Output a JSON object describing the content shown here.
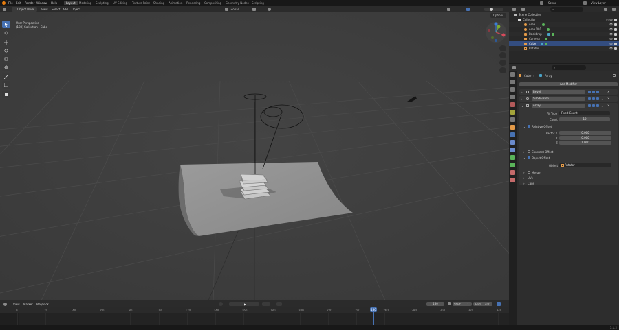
{
  "topbar": {
    "menus": [
      "File",
      "Edit",
      "Render",
      "Window",
      "Help"
    ],
    "workspaces": [
      "Layout",
      "Modeling",
      "Sculpting",
      "UV Editing",
      "Texture Paint",
      "Shading",
      "Animation",
      "Rendering",
      "Compositing",
      "Geometry Nodes",
      "Scripting"
    ],
    "active_workspace": "Layout",
    "scene": "Scene",
    "view_layer": "View Layer"
  },
  "viewport_header": {
    "mode": "Object Mode",
    "menus": [
      "View",
      "Select",
      "Add",
      "Object"
    ],
    "orientation": "Global",
    "options": "Options"
  },
  "viewport": {
    "perspective": "User Perspective",
    "collection_info": "(180) Collection | Cube"
  },
  "outliner": {
    "root": "Scene Collection",
    "collection": "Collection",
    "items": [
      {
        "name": "Area",
        "icon": "light-icon",
        "selected": false
      },
      {
        "name": "Area.001",
        "icon": "light-icon",
        "selected": false
      },
      {
        "name": "Backdrop",
        "icon": "mesh-icon",
        "selected": false
      },
      {
        "name": "Camera",
        "icon": "camera-icon",
        "selected": false
      },
      {
        "name": "Cube",
        "icon": "mesh-icon",
        "selected": true
      },
      {
        "name": "Rotator",
        "icon": "empty-icon",
        "selected": false
      }
    ]
  },
  "properties": {
    "breadcrumb_object": "Cube",
    "breadcrumb_modifier": "Array",
    "add_modifier": "Add Modifier",
    "modifiers": [
      "Bevel",
      "Subdivision",
      "Array"
    ],
    "fit_type_label": "Fit Type",
    "fit_type_value": "Fixed Count",
    "count_label": "Count",
    "count_value": "10",
    "relative_offset": "Relative Offset",
    "factor_x_label": "Factor X",
    "factor_x": "0.000",
    "y_label": "Y",
    "factor_y": "0.000",
    "z_label": "Z",
    "factor_z": "1.000",
    "constant_offset": "Constant Offset",
    "object_offset": "Object Offset",
    "object_label": "Object",
    "object_value": "Rotator",
    "merge": "Merge",
    "uvs": "UVs",
    "caps": "Caps"
  },
  "timeline": {
    "menus": [
      "View",
      "Marker",
      "Playback"
    ],
    "current_frame": "180",
    "start_label": "Start",
    "start": "1",
    "end_label": "End",
    "end": "400",
    "ticks": [
      "0",
      "20",
      "40",
      "60",
      "80",
      "100",
      "120",
      "140",
      "160",
      "180",
      "200",
      "220",
      "240",
      "260",
      "280",
      "300",
      "320",
      "340"
    ],
    "playhead_frame": "180"
  },
  "status": {
    "version": "3.1.2"
  },
  "colors": {
    "accent": "#4772b3",
    "playhead": "#4772b3",
    "selection": "#334d80"
  }
}
